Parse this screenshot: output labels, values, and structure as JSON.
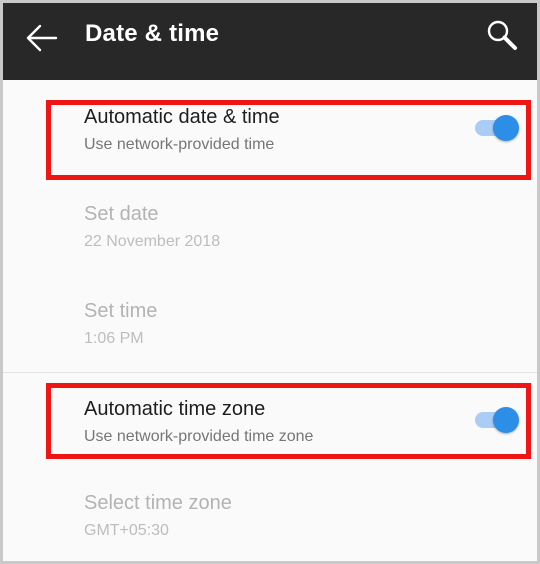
{
  "appbar": {
    "title": "Date & time",
    "back_icon": "back-arrow-icon",
    "search_icon": "search-icon",
    "background": "#282828"
  },
  "settings": [
    {
      "title": "Automatic date & time",
      "subtitle": "Use network-provided time",
      "toggle": true,
      "enabled": true
    },
    {
      "title": "Set date",
      "subtitle": "22 November 2018",
      "enabled": false
    },
    {
      "title": "Set time",
      "subtitle": "1:06 PM",
      "enabled": false
    },
    {
      "title": "Automatic time zone",
      "subtitle": "Use network-provided time zone",
      "toggle": true,
      "enabled": true
    },
    {
      "title": "Select time zone",
      "subtitle": "GMT+05:30",
      "enabled": false
    }
  ],
  "colors": {
    "accent": "#2d8ee8",
    "highlight": "#ef1515",
    "disabled_text": "#b3b3b3"
  }
}
